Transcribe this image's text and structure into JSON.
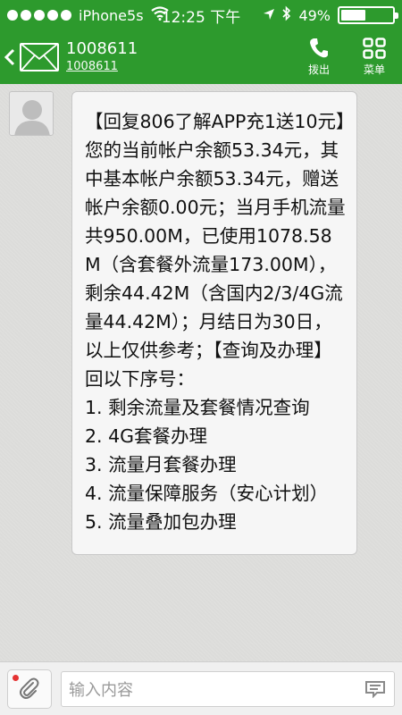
{
  "status_bar": {
    "carrier": "iPhone5s",
    "time": "12:25 下午",
    "battery": "49%",
    "battery_level": 0.49
  },
  "header": {
    "contact_name": "1008611",
    "contact_number": "1008611",
    "call_label": "拨出",
    "menu_label": "菜单"
  },
  "message": {
    "text": "【回复806了解APP充1送10元】您的当前帐户余额53.34元，其中基本帐户余额53.34元，赠送帐户余额0.00元；当月手机流量共950.00M，已使用1078.58M（含套餐外流量173.00M），剩余44.42M（含国内2/3/4G流量44.42M）；月结日为30日，以上仅供参考；【查询及办理】回以下序号：\n1. 剩余流量及套餐情况查询\n2. 4G套餐办理\n3. 流量月套餐办理\n4. 流量保障服务（安心计划）\n5. 流量叠加包办理"
  },
  "input": {
    "placeholder": "输入内容"
  },
  "colors": {
    "header_green": "#2d9a2d",
    "attach_badge": "#e53333"
  }
}
